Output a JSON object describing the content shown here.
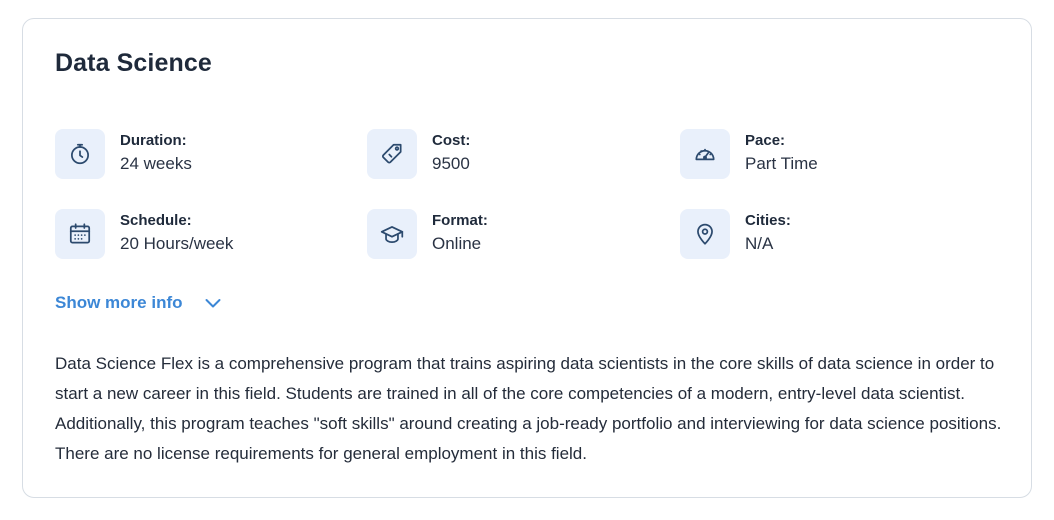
{
  "card": {
    "title": "Data Science",
    "info_items": [
      {
        "label": "Duration:",
        "value": "24 weeks",
        "icon": "stopwatch-icon"
      },
      {
        "label": "Cost:",
        "value": "9500",
        "icon": "price-tag-icon"
      },
      {
        "label": "Pace:",
        "value": "Part Time",
        "icon": "speedometer-icon"
      },
      {
        "label": "Schedule:",
        "value": "20 Hours/week",
        "icon": "calendar-icon"
      },
      {
        "label": "Format:",
        "value": "Online",
        "icon": "graduation-cap-icon"
      },
      {
        "label": "Cities:",
        "value": "N/A",
        "icon": "map-pin-icon"
      }
    ],
    "show_more_label": "Show more info",
    "description": "Data Science Flex is a comprehensive program that trains aspiring data scientists in the core skills of data science in order to start a new career in this field. Students are trained in all of the core competencies of a modern, entry-level data scientist. Additionally, this program teaches \"soft skills\" around creating a job-ready portfolio and interviewing for data science positions. There are no license requirements for general employment in this field."
  },
  "colors": {
    "accent": "#3c87d6",
    "icon_bg": "#e9f0fb",
    "icon_stroke": "#2c4a6e",
    "border": "#d7dde4",
    "text": "#1f2a3b"
  }
}
